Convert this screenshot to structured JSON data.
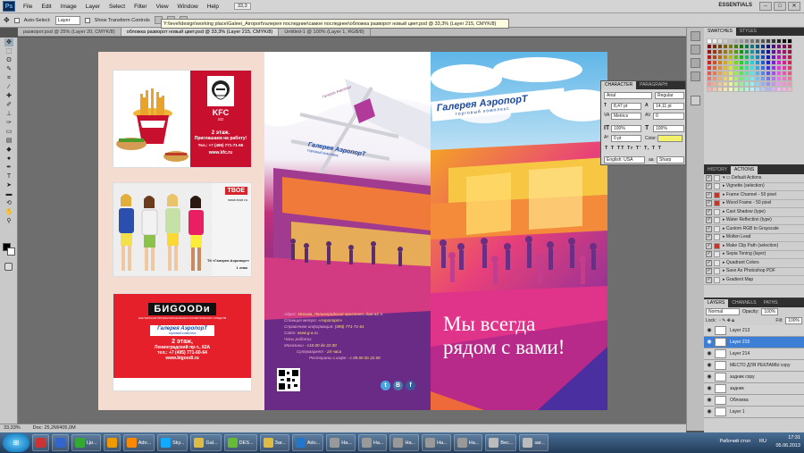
{
  "menubar": {
    "logo": "Ps",
    "items": [
      "File",
      "Edit",
      "Image",
      "Layer",
      "Select",
      "Filter",
      "View",
      "Window",
      "Help"
    ],
    "zoom": "33,3",
    "workspace": "ESSENTIALS"
  },
  "options": {
    "auto_select_label": "Auto-Select:",
    "auto_select_value": "Layer",
    "transform_label": "Show Transform Controls"
  },
  "path_tooltip": "Y:\\level\\design\\working place\\Galeei_Airoport\\галерея последние\\самое последнее\\обложка разворот новый цвет.psd @ 33,3% (Layer 215, CMYK/8)",
  "tabs": [
    {
      "label": "разворот.psd @ 25% (Layer 20, CMYK/8)",
      "active": false
    },
    {
      "label": "обложка разворот новый цвет.psd @ 33,3% (Layer 215, CMYK/8)",
      "active": true
    },
    {
      "label": "Untitled-1 @ 100% (Layer 1, RGB/8)",
      "active": false
    }
  ],
  "status": {
    "zoom": "33,33%",
    "doc": "Doc: 25,2M/405,0M"
  },
  "ads": {
    "kfc": {
      "logo": "KFC",
      "sub": "SO",
      "text1": "2 этаж.",
      "text2": "Приглашаем на работу!",
      "phone": "Тел.: +7 (495) 771-71-65",
      "site": "www.kfc.ru",
      "bucket": "KFC"
    },
    "tvoe": {
      "logo": "TBOE",
      "site": "www.tvoe.ru",
      "text1": "ТК «Галерея Аэропорт»",
      "text2": "1 этаж"
    },
    "bigoodi": {
      "logo": "БИGOODи",
      "tag": "МАСТЕРСКАЯ ПРОФЕССИОНАЛЬНЫХ КОСМЕТИЧЕСКИХ СРЕДСТВ",
      "gallery": "Галерея АэропорТ",
      "gallery_sub": "торговый комплекс",
      "floor": "2 этаж,",
      "addr": "Ленинградский пр-т., 62А",
      "phone": "тел.: +7 (495) 771-60-64",
      "site": "www.bigoodi.ru"
    }
  },
  "middle_page": {
    "gallery": "Галерея АэропорТ",
    "gallery_sub": "торговый комплекс",
    "info": [
      {
        "label": "Адрес:",
        "value": "Москва, Ленинградский проспект, дом 62 А"
      },
      {
        "label": "Станция метро:",
        "value": "«Аэропорт»"
      },
      {
        "label": "Справочная информация:",
        "value": "(495) 771-71-61"
      },
      {
        "label": "Сайт:",
        "value": "www.g-a.ru"
      },
      {
        "label": "Часы работы:",
        "value": ""
      },
      {
        "label": "Магазины",
        "value": "- с10.00 до 22.00"
      },
      {
        "label": "Супермаркет",
        "value": "- 24 часа"
      },
      {
        "label": "Рестораны и кафе",
        "value": "- с 09.00 до 22.00"
      }
    ],
    "map_label": "Галерея Аэропорт",
    "social": [
      "t",
      "B",
      "f"
    ]
  },
  "cover": {
    "gallery": "Галерея АэропорТ",
    "gallery_sub": "торговый комплекс",
    "slogan1": "Мы всегда",
    "slogan2": "рядом с вами!"
  },
  "character_panel": {
    "tabs": [
      "CHARACTER",
      "PARAGRAPH"
    ],
    "font": "Arial",
    "style": "Regular",
    "size": "8,47 pt",
    "leading": "14,11 pt",
    "kerning": "Metrics",
    "tracking": "0",
    "vscale": "100%",
    "hscale": "100%",
    "baseline": "0 pt",
    "color_label": "Color:",
    "styles": "T T TT Tr T' T, T T",
    "lang": "English: USA",
    "aa": "Sharp"
  },
  "swatches_tabs": [
    "SWATCHES",
    "STYLES"
  ],
  "actions": {
    "tabs": [
      "HISTORY",
      "ACTIONS"
    ],
    "items": [
      {
        "label": "Default Actions",
        "red": false
      },
      {
        "label": "Vignette (selection)",
        "red": false
      },
      {
        "label": "Frame Channel - 50 pixel",
        "red": true
      },
      {
        "label": "Wood Frame - 50 pixel",
        "red": true
      },
      {
        "label": "Cast Shadow (type)",
        "red": false
      },
      {
        "label": "Water Reflection (type)",
        "red": false
      },
      {
        "label": "Custom RGB to Grayscale",
        "red": false
      },
      {
        "label": "Molten Lead",
        "red": false
      },
      {
        "label": "Make Clip Path (selection)",
        "red": true
      },
      {
        "label": "Sepia Toning (layer)",
        "red": false
      },
      {
        "label": "Quadrant Colors",
        "red": false
      },
      {
        "label": "Save As Photoshop PDF",
        "red": false
      },
      {
        "label": "Gradient Map",
        "red": false
      }
    ]
  },
  "layers": {
    "tabs": [
      "LAYERS",
      "CHANNELS",
      "PATHS"
    ],
    "blend": "Normal",
    "opacity_label": "Opacity:",
    "opacity": "100%",
    "lock_label": "Lock:",
    "fill_label": "Fill:",
    "fill": "100%",
    "items": [
      {
        "name": "Layer 213",
        "selected": false
      },
      {
        "name": "Layer 215",
        "selected": true
      },
      {
        "name": "Layer 214",
        "selected": false
      },
      {
        "name": "МЕСТО ДЛЯ РЕКЛАМЫ copy",
        "selected": false
      },
      {
        "name": "задник copy",
        "selected": false
      },
      {
        "name": "задник",
        "selected": false
      },
      {
        "name": "Обложка",
        "selected": false
      },
      {
        "name": "Layer 1",
        "selected": false
      }
    ]
  },
  "taskbar": {
    "start": "⊞",
    "items": [
      {
        "label": "",
        "color": "#c33"
      },
      {
        "label": "",
        "color": "#36c"
      },
      {
        "label": "Ци...",
        "color": "#3a3"
      },
      {
        "label": "",
        "color": "#e90"
      },
      {
        "label": "Ado...",
        "color": "#f80"
      },
      {
        "label": "Sky...",
        "color": "#1af"
      },
      {
        "label": "Gal...",
        "color": "#db4"
      },
      {
        "label": "DES...",
        "color": "#6b3"
      },
      {
        "label": "Заг...",
        "color": "#db4"
      },
      {
        "label": "Ado...",
        "color": "#27c"
      },
      {
        "label": "На...",
        "color": "#999"
      },
      {
        "label": "На...",
        "color": "#999"
      },
      {
        "label": "На...",
        "color": "#999"
      },
      {
        "label": "На...",
        "color": "#999"
      },
      {
        "label": "На...",
        "color": "#999"
      },
      {
        "label": "Вес...",
        "color": "#bbb"
      },
      {
        "label": "заг...",
        "color": "#bbb"
      }
    ],
    "desktop": "Рабочий стол",
    "lang": "RU",
    "time": "17:31",
    "date": "05.06.2013"
  }
}
